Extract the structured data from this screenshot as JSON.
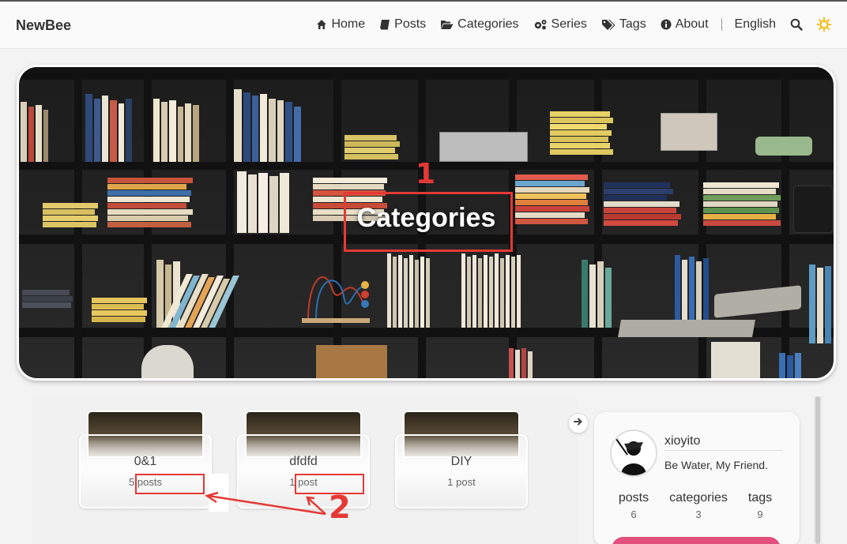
{
  "nav": {
    "brand": "NewBee",
    "items": [
      {
        "label": "Home",
        "icon": "home-icon"
      },
      {
        "label": "Posts",
        "icon": "book-icon"
      },
      {
        "label": "Categories",
        "icon": "folder-open-icon"
      },
      {
        "label": "Series",
        "icon": "cogs-icon"
      },
      {
        "label": "Tags",
        "icon": "tags-icon"
      },
      {
        "label": "About",
        "icon": "info-circle-icon"
      }
    ],
    "language": "English"
  },
  "hero": {
    "title": "Categories"
  },
  "annotations": {
    "one": "1",
    "two": "2",
    "color": "#e53935"
  },
  "categories": [
    {
      "name": "0&1",
      "count": "5",
      "unit": "posts"
    },
    {
      "name": "dfdfd",
      "count": "1",
      "unit": "post"
    },
    {
      "name": "DIY",
      "count": "1",
      "unit": "post"
    }
  ],
  "profile": {
    "name": "xioyito",
    "motto": "Be Water, My Friend.",
    "stats": [
      {
        "label": "posts",
        "value": "6"
      },
      {
        "label": "categories",
        "value": "3"
      },
      {
        "label": "tags",
        "value": "9"
      }
    ]
  },
  "colors": {
    "accent": "#e2507b",
    "sun": "#f5b800"
  }
}
